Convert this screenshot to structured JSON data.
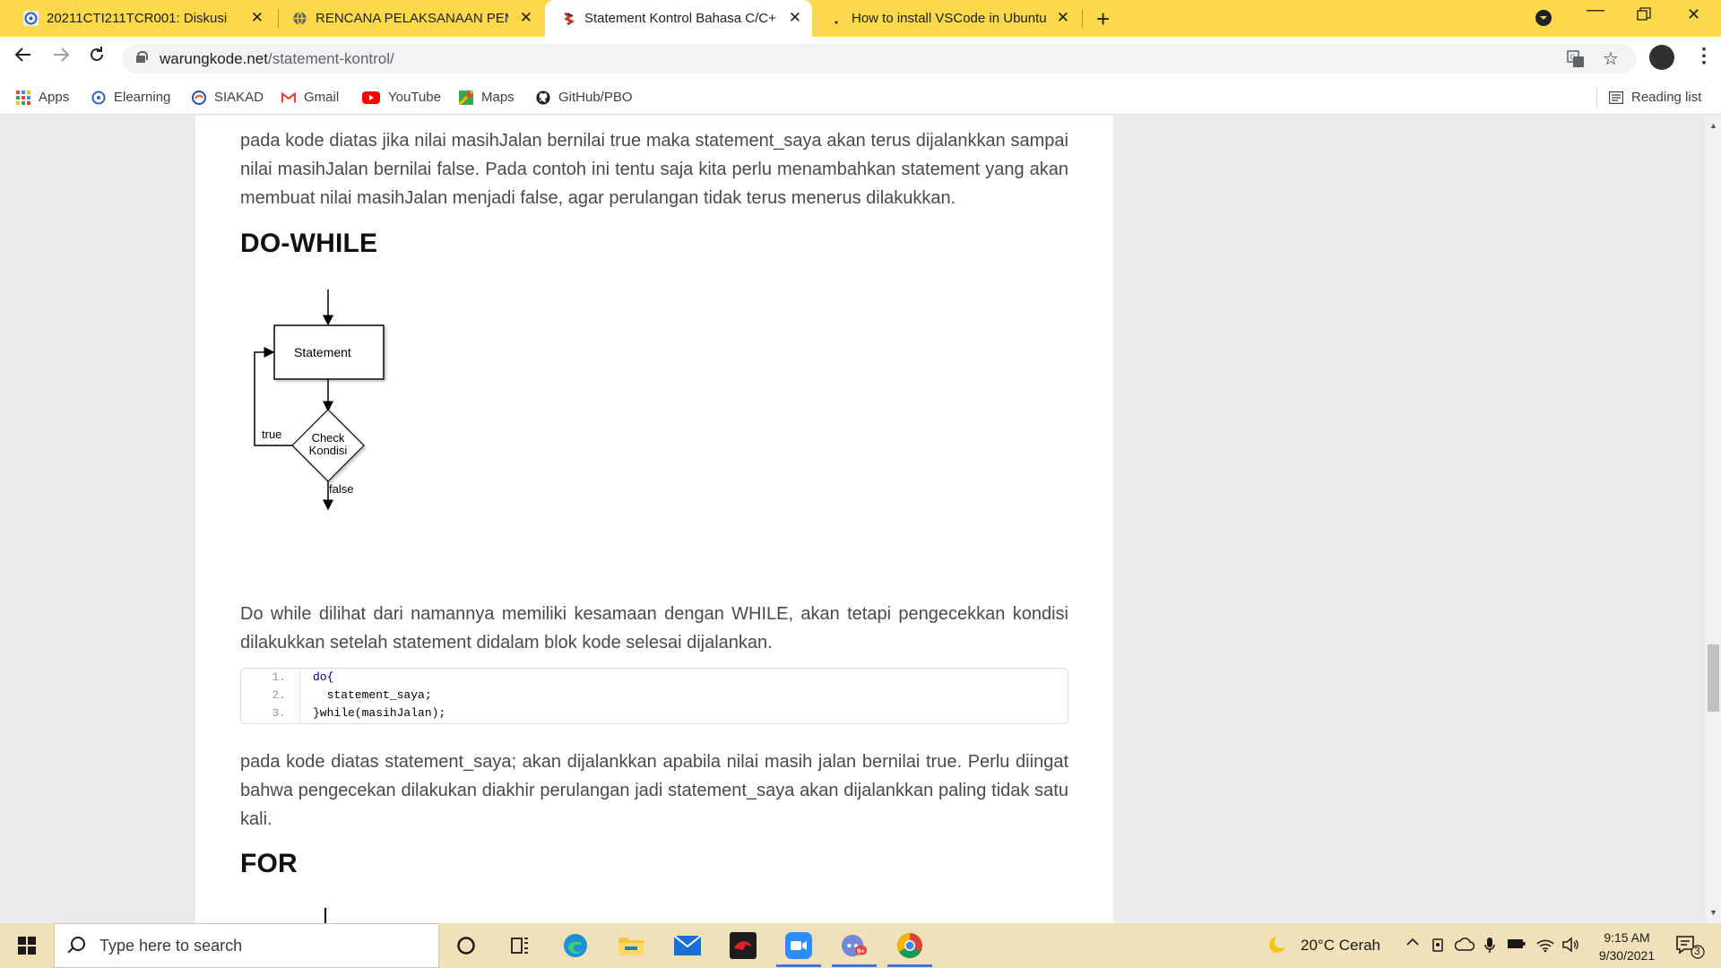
{
  "browser": {
    "tabs": [
      {
        "title": "20211CTI211TCR001: Diskusi",
        "favicon": "elearning-icon",
        "active": false
      },
      {
        "title": "RENCANA PELAKSANAAN PEMB",
        "favicon": "globe-icon",
        "active": false
      },
      {
        "title": "Statement Kontrol Bahasa C/C++",
        "favicon": "warungkode-icon",
        "active": true
      },
      {
        "title": "How to install VSCode in Ubuntu",
        "favicon": "ubuntu-icon",
        "active": false
      }
    ],
    "url_host": "warungkode.net",
    "url_path": "/statement-kontrol/",
    "bookmarks": [
      {
        "label": "Apps",
        "icon": "apps-grid-icon"
      },
      {
        "label": "Elearning",
        "icon": "elearning-icon"
      },
      {
        "label": "SIAKAD",
        "icon": "siakad-icon"
      },
      {
        "label": "Gmail",
        "icon": "gmail-icon"
      },
      {
        "label": "YouTube",
        "icon": "youtube-icon"
      },
      {
        "label": "Maps",
        "icon": "maps-icon"
      },
      {
        "label": "GitHub/PBO",
        "icon": "github-icon"
      }
    ],
    "reading_list": "Reading list",
    "colors": {
      "tabstrip": "#fcd94a",
      "taskbar": "#f0e1b9"
    }
  },
  "article": {
    "para1": "pada kode diatas jika nilai masihJalan bernilai true maka statement_saya akan terus dijalankkan sampai nilai masihJalan bernilai false. Pada contoh ini tentu saja kita perlu menambahkan statement yang akan membuat nilai masihJalan menjadi false, agar perulangan tidak terus menerus dilakukkan.",
    "heading_dowhile": "DO-WHILE",
    "flowchart": {
      "statement": "Statement",
      "check_line1": "Check",
      "check_line2": "Kondisi",
      "true_label": "true",
      "false_label": "false"
    },
    "para2": "Do while dilihat dari namannya memiliki kesamaan dengan WHILE, akan tetapi pengecekkan kondisi dilakukkan setelah statement didalam blok kode selesai dijalankan.",
    "code": [
      {
        "num": "1.",
        "text": "do{"
      },
      {
        "num": "2.",
        "text": "  statement_saya;"
      },
      {
        "num": "3.",
        "text": "}while(masihJalan);"
      }
    ],
    "para3": "pada kode diatas statement_saya; akan dijalankkan apabila nilai masih jalan bernilai true. Perlu diingat bahwa pengecekan dilakukan diakhir perulangan jadi statement_saya akan dijalankkan paling tidak satu kali.",
    "heading_for": "FOR"
  },
  "taskbar": {
    "search_placeholder": "Type here to search",
    "weather": "20°C  Cerah",
    "time": "9:15 AM",
    "date": "9/30/2021",
    "notification_count": "3"
  }
}
